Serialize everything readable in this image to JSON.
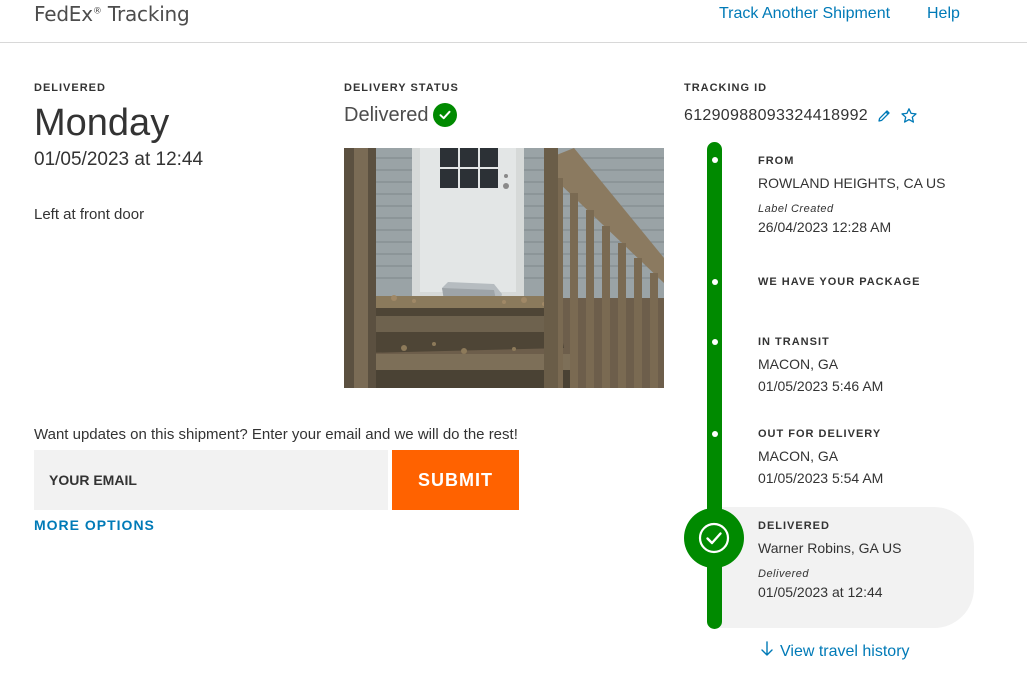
{
  "header": {
    "brand": "FedEx",
    "brand_reg": "®",
    "brand_suffix": " Tracking",
    "nav": {
      "track_another": "Track Another Shipment",
      "help": "Help"
    }
  },
  "summary": {
    "delivered_label": "DELIVERED",
    "day": "Monday",
    "datetime": "01/05/2023 at 12:44",
    "note": "Left at front door"
  },
  "delivery_status": {
    "label": "DELIVERY STATUS",
    "value": "Delivered"
  },
  "email": {
    "prompt": "Want updates on this shipment? Enter your email and we will do the rest!",
    "placeholder": "YOUR EMAIL",
    "submit": "SUBMIT",
    "more_options": "MORE OPTIONS"
  },
  "tracking": {
    "label": "TRACKING ID",
    "id": "61290988093324418992"
  },
  "timeline": {
    "from": {
      "title": "FROM",
      "location": "ROWLAND HEIGHTS, CA US",
      "sub": "Label Created",
      "date": "26/04/2023 12:28 AM"
    },
    "have_package": {
      "title": "WE HAVE YOUR PACKAGE"
    },
    "in_transit": {
      "title": "IN TRANSIT",
      "location": "MACON, GA",
      "date": "01/05/2023 5:46 AM"
    },
    "out_for_delivery": {
      "title": "OUT FOR DELIVERY",
      "location": "MACON, GA",
      "date": "01/05/2023 5:54 AM"
    },
    "delivered": {
      "title": "DELIVERED",
      "location": "Warner Robins, GA US",
      "sub": "Delivered",
      "date": "01/05/2023 at 12:44"
    }
  },
  "view_history": "View travel history",
  "colors": {
    "brand_green": "#008a00",
    "link_blue": "#007ab7",
    "submit_orange": "#ff6200"
  },
  "icons": [
    "check-circle-icon",
    "pencil-icon",
    "star-outline-icon",
    "arrow-down-icon"
  ]
}
